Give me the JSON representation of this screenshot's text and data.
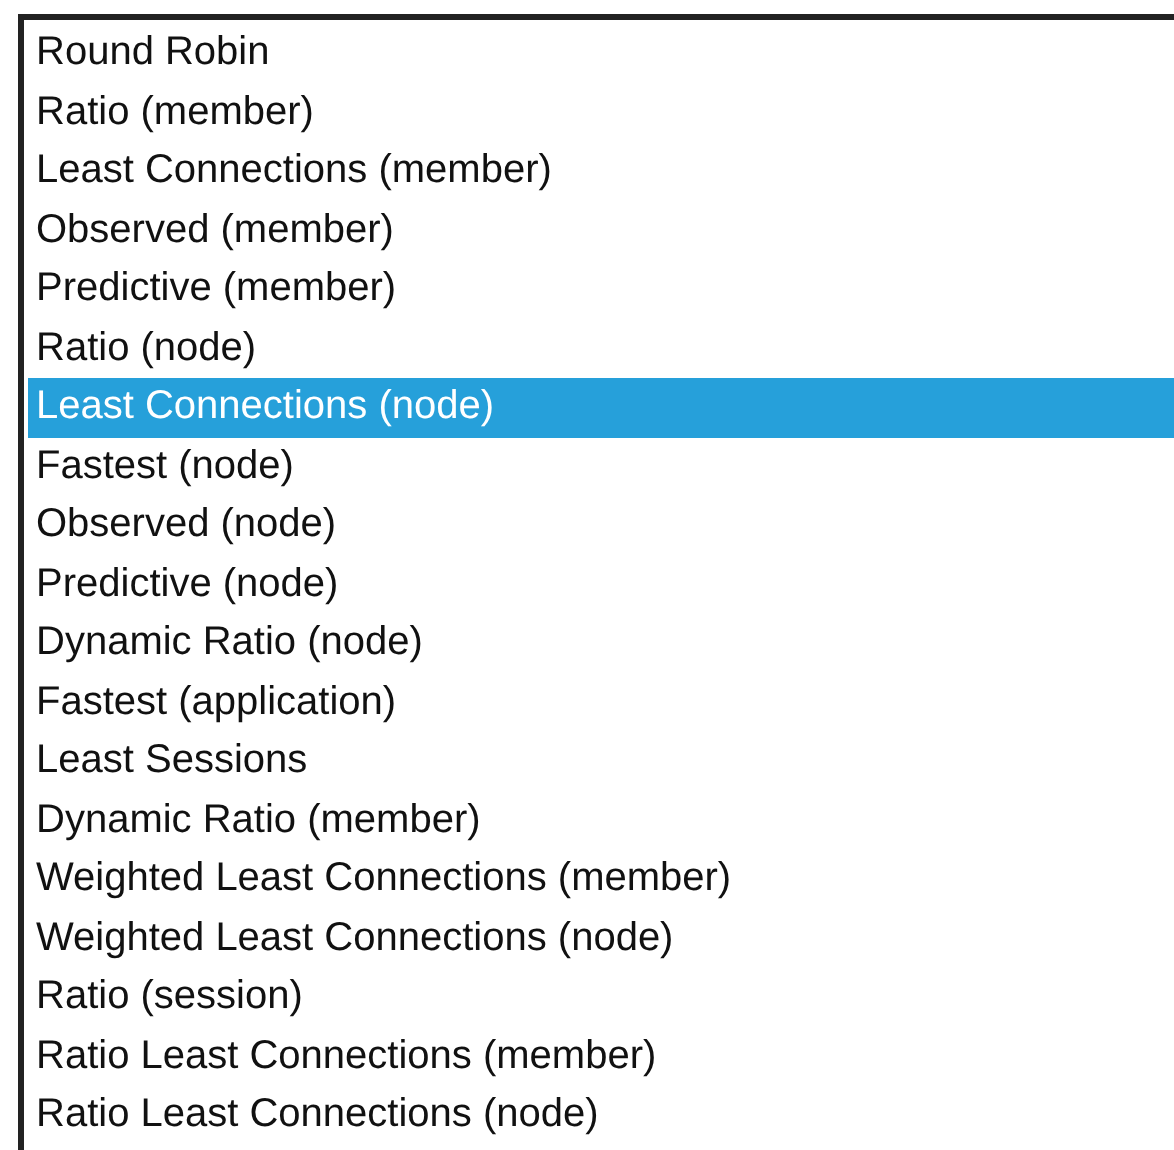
{
  "listbox": {
    "options": [
      {
        "label": "Round Robin",
        "selected": false
      },
      {
        "label": "Ratio (member)",
        "selected": false
      },
      {
        "label": "Least Connections (member)",
        "selected": false
      },
      {
        "label": "Observed (member)",
        "selected": false
      },
      {
        "label": "Predictive (member)",
        "selected": false
      },
      {
        "label": "Ratio (node)",
        "selected": false
      },
      {
        "label": "Least Connections (node)",
        "selected": true
      },
      {
        "label": "Fastest (node)",
        "selected": false
      },
      {
        "label": "Observed (node)",
        "selected": false
      },
      {
        "label": "Predictive (node)",
        "selected": false
      },
      {
        "label": "Dynamic Ratio (node)",
        "selected": false
      },
      {
        "label": "Fastest (application)",
        "selected": false
      },
      {
        "label": "Least Sessions",
        "selected": false
      },
      {
        "label": "Dynamic Ratio (member)",
        "selected": false
      },
      {
        "label": "Weighted Least Connections (member)",
        "selected": false
      },
      {
        "label": "Weighted Least Connections (node)",
        "selected": false
      },
      {
        "label": "Ratio (session)",
        "selected": false
      },
      {
        "label": "Ratio Least Connections (member)",
        "selected": false
      },
      {
        "label": "Ratio Least Connections (node)",
        "selected": false
      }
    ]
  }
}
